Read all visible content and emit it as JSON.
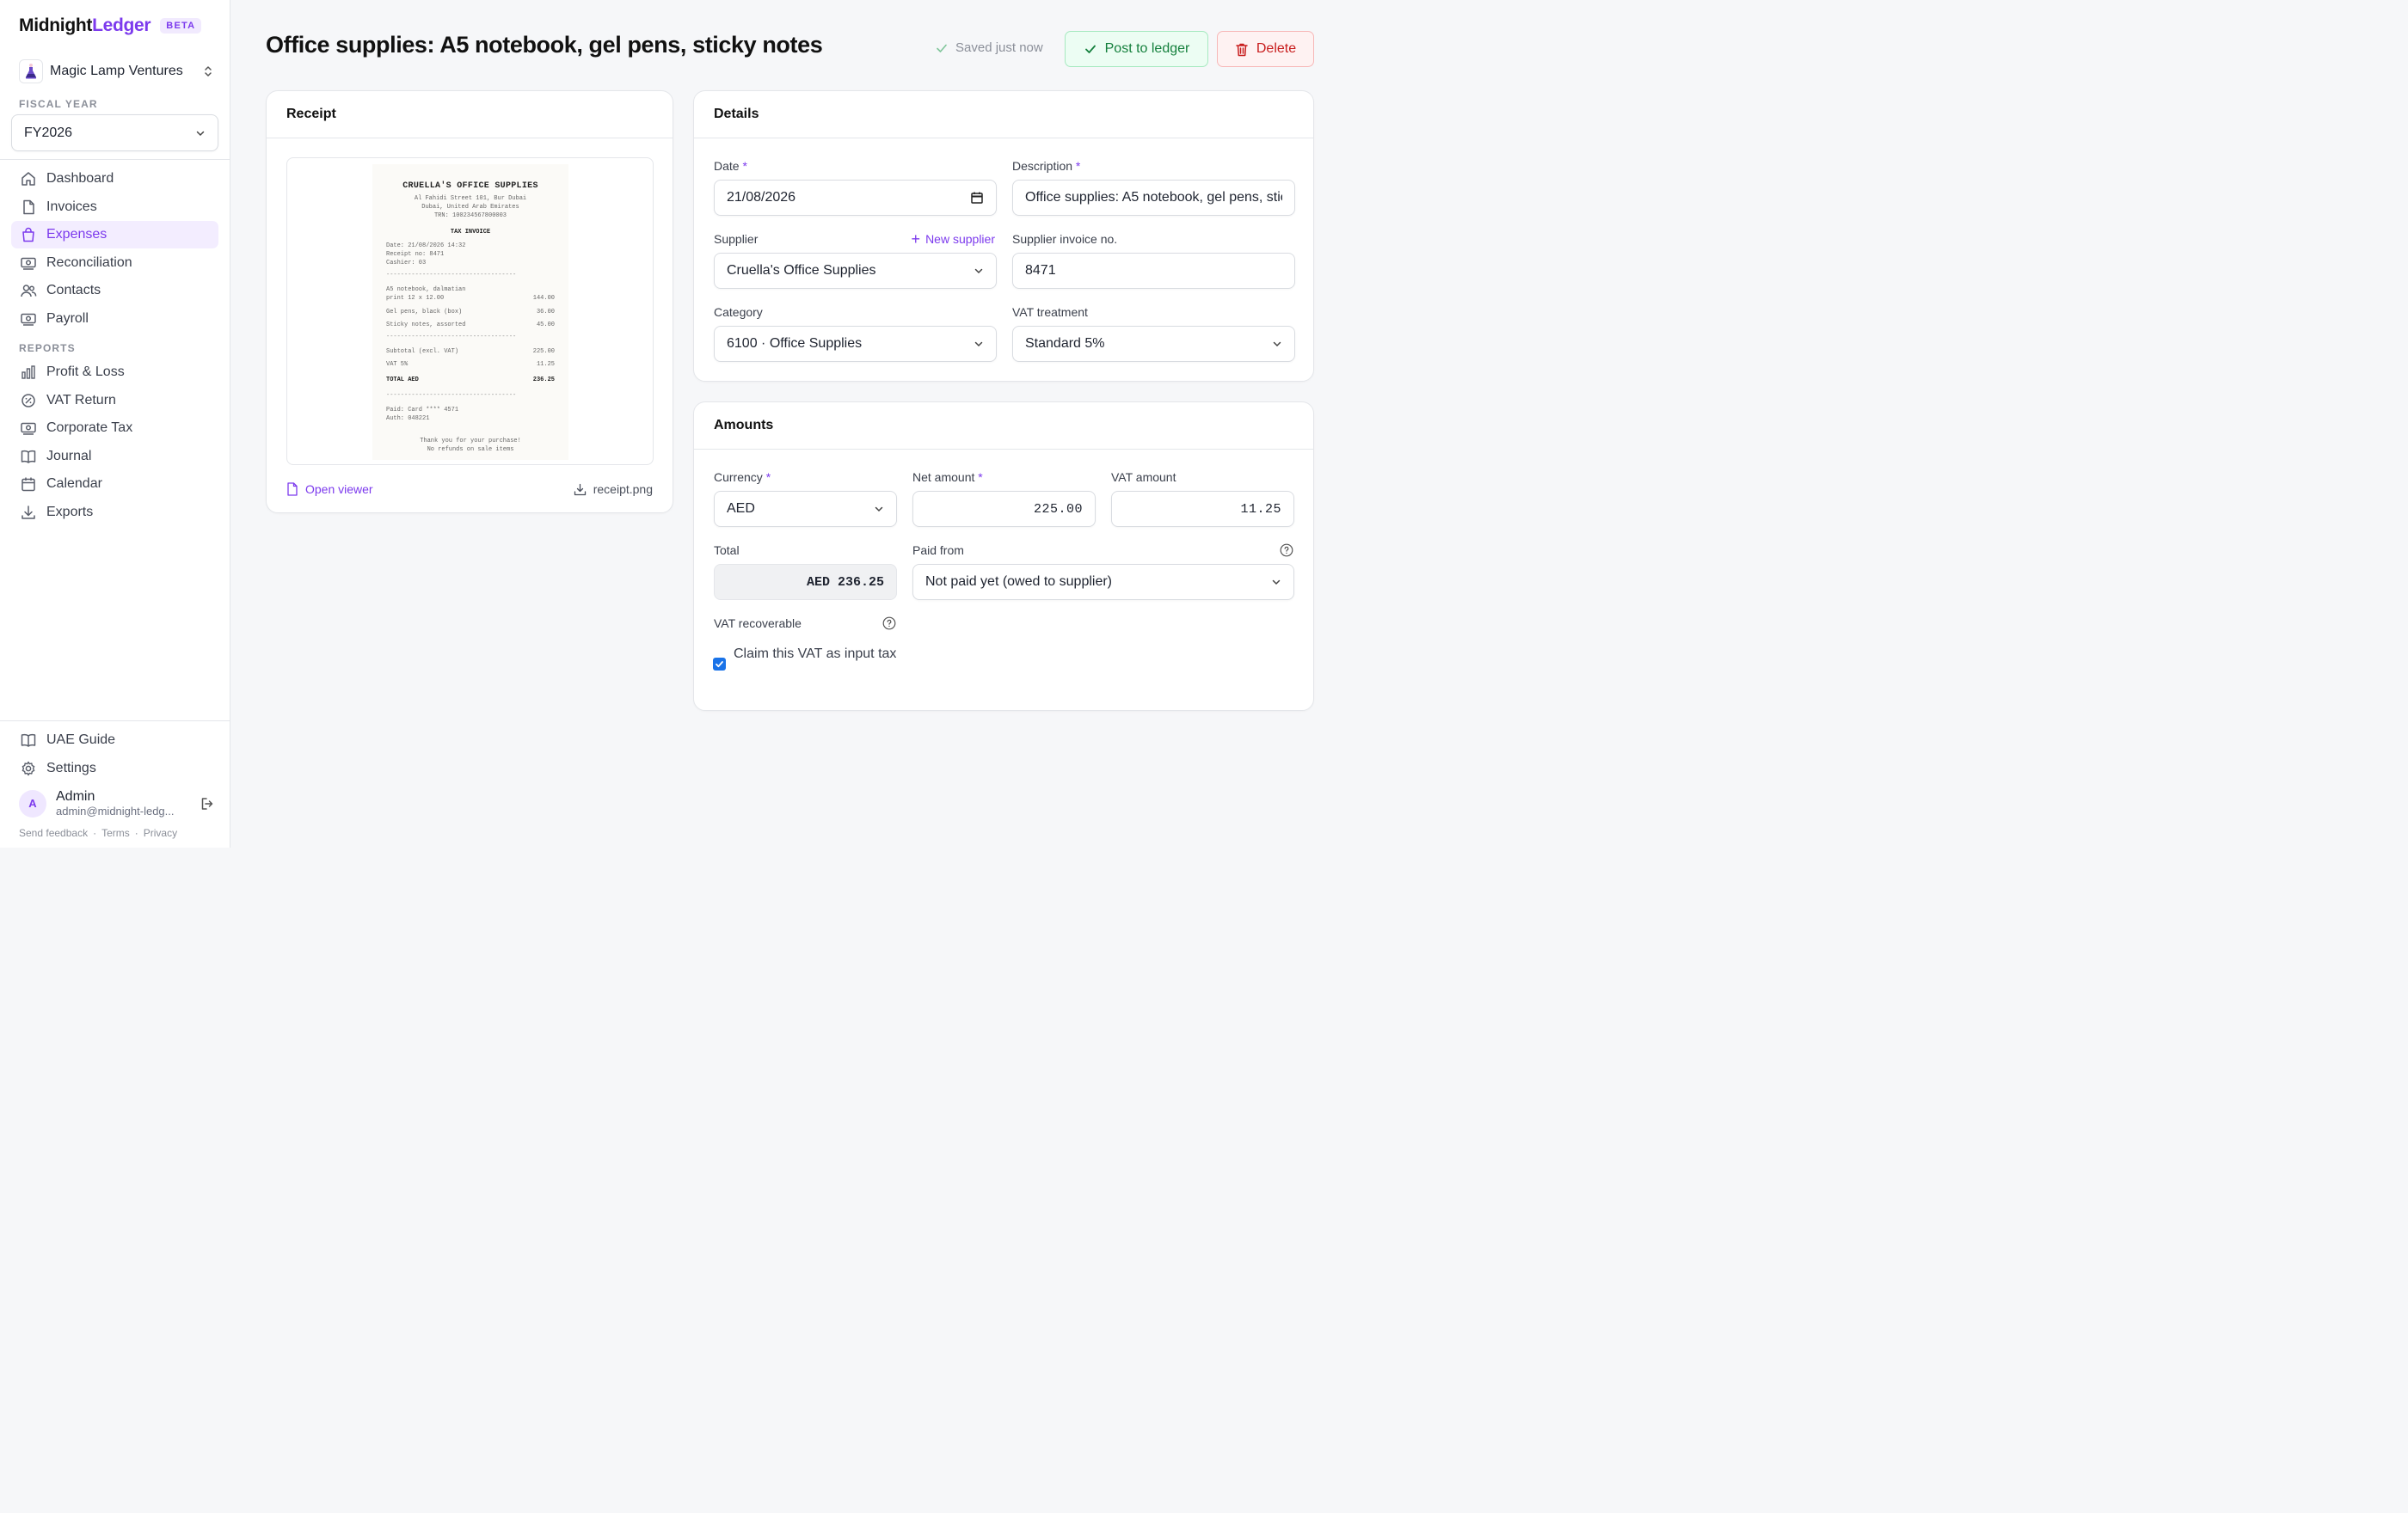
{
  "app": {
    "brand_first": "Midnight",
    "brand_second": "Ledger",
    "badge": "BETA",
    "org_name": "Magic Lamp Ventures"
  },
  "sidebar": {
    "fiscal_year_label": "FISCAL YEAR",
    "fiscal_year_value": "FY2026",
    "items": [
      {
        "label": "Dashboard",
        "icon": "home-icon"
      },
      {
        "label": "Invoices",
        "icon": "document-icon"
      },
      {
        "label": "Expenses",
        "icon": "shopping-bag-icon",
        "active": true
      },
      {
        "label": "Reconciliation",
        "icon": "banknote-icon"
      },
      {
        "label": "Contacts",
        "icon": "users-icon"
      },
      {
        "label": "Payroll",
        "icon": "banknote-icon"
      }
    ],
    "reports_label": "REPORTS",
    "reports": [
      {
        "label": "Profit & Loss",
        "icon": "bar-chart-icon"
      },
      {
        "label": "VAT Return",
        "icon": "percent-badge-icon"
      },
      {
        "label": "Corporate Tax",
        "icon": "banknote-icon"
      },
      {
        "label": "Journal",
        "icon": "book-open-icon"
      },
      {
        "label": "Calendar",
        "icon": "calendar-icon"
      },
      {
        "label": "Exports",
        "icon": "download-icon"
      }
    ],
    "bottom": [
      {
        "label": "UAE Guide",
        "icon": "book-open-icon"
      },
      {
        "label": "Settings",
        "icon": "gear-icon"
      }
    ],
    "user": {
      "initial": "A",
      "name": "Admin",
      "email": "admin@midnight-ledg..."
    },
    "footer": [
      "Send feedback",
      "Terms",
      "Privacy"
    ]
  },
  "header": {
    "title": "Office supplies: A5 notebook, gel pens, sticky notes",
    "saved_status": "Saved just now",
    "post_label": "Post to ledger",
    "delete_label": "Delete"
  },
  "receipt_card": {
    "title": "Receipt",
    "open_viewer": "Open viewer",
    "file_name": "receipt.png",
    "receipt": {
      "shop": "CRUELLA'S OFFICE SUPPLIES",
      "address1": "Al Fahidi Street 101, Bur Dubai",
      "address2": "Dubai, United Arab Emirates",
      "trn": "TRN: 100234567800003",
      "doc_title": "TAX INVOICE",
      "date": "Date: 21/08/2026 14:32",
      "receipt_no": "Receipt no: 8471",
      "cashier": "Cashier: 03",
      "separator": "------------------------------------",
      "line1a": "A5 notebook, dalmatian",
      "line1b": "print 12 x 12.00",
      "line1_amt": "144.00",
      "line2": "Gel pens, black (box)",
      "line2_amt": "36.00",
      "line3": "Sticky notes, assorted",
      "line3_amt": "45.00",
      "subtotal": "Subtotal (excl. VAT)",
      "subtotal_amt": "225.00",
      "vat": "VAT 5%",
      "vat_amt": "11.25",
      "total": "TOTAL AED",
      "total_amt": "236.25",
      "paid": "Paid: Card **** 4571",
      "auth": "Auth: 048221",
      "thanks1": "Thank you for your purchase!",
      "thanks2": "No refunds on sale items"
    }
  },
  "details_card": {
    "title": "Details",
    "date_label": "Date",
    "date_value": "21/08/2026",
    "description_label": "Description",
    "description_value": "Office supplies: A5 notebook, gel pens, sticky notes",
    "supplier_label": "Supplier",
    "new_supplier": "New supplier",
    "supplier_value": "Cruella's Office Supplies",
    "supplier_invoice_label": "Supplier invoice no.",
    "supplier_invoice_value": "8471",
    "category_label": "Category",
    "category_value": "6100 · Office Supplies",
    "vat_treatment_label": "VAT treatment",
    "vat_treatment_value": "Standard 5%"
  },
  "amounts_card": {
    "title": "Amounts",
    "currency_label": "Currency",
    "currency_value": "AED",
    "net_label": "Net amount",
    "net_value": "225.00",
    "vat_label": "VAT amount",
    "vat_value": "11.25",
    "total_label": "Total",
    "total_value": "AED 236.25",
    "paid_from_label": "Paid from",
    "paid_from_value": "Not paid yet (owed to supplier)",
    "vat_recoverable_label": "VAT recoverable",
    "claim_label": "Claim this VAT as input tax",
    "claim_checked": true
  },
  "required_mark": "*",
  "colors": {
    "accent": "#7c3aed",
    "success": "#15803d",
    "danger": "#c81e1e"
  }
}
